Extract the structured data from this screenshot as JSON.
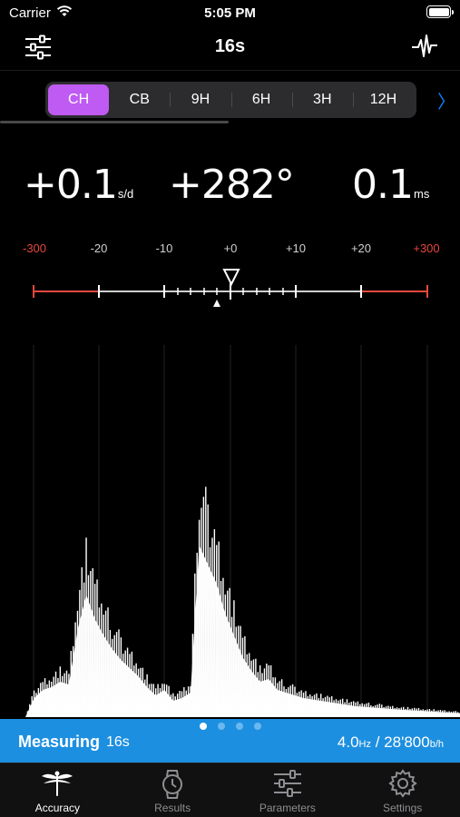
{
  "status_bar": {
    "carrier": "Carrier",
    "time": "5:05 PM"
  },
  "nav": {
    "title": "16s",
    "left_icon": "sliders-icon",
    "right_icon": "waveform-icon"
  },
  "positions": {
    "items": [
      "CH",
      "CB",
      "9H",
      "6H",
      "3H",
      "12H"
    ],
    "selected": "CH",
    "next_chevron": "〉"
  },
  "readouts": {
    "rate": {
      "value": "+0.1",
      "unit": "s/d"
    },
    "amplitude": {
      "value": "+282°"
    },
    "beat_error": {
      "value": "0.1",
      "unit": "ms"
    }
  },
  "scale": {
    "labels": [
      "-300",
      "-20",
      "-10",
      "+0",
      "+10",
      "+20",
      "+300"
    ],
    "red_color": "#e5483e"
  },
  "chart_data": {
    "type": "area",
    "note_values": "relative intensity 0-1 across the timegrapher window",
    "x": [
      0,
      2,
      4,
      6,
      8,
      10,
      12,
      14,
      16,
      18,
      20,
      22,
      24,
      26,
      28,
      30,
      32,
      34,
      36,
      38,
      40,
      42,
      44,
      46,
      48,
      50,
      52,
      54,
      56,
      58,
      60,
      62,
      64,
      66,
      68,
      70,
      72,
      74,
      76,
      78,
      80,
      82,
      84,
      86,
      88,
      90,
      92,
      94,
      96,
      98,
      100
    ],
    "values": [
      0.0,
      0.07,
      0.1,
      0.11,
      0.13,
      0.12,
      0.32,
      0.45,
      0.36,
      0.3,
      0.25,
      0.21,
      0.18,
      0.15,
      0.11,
      0.08,
      0.1,
      0.06,
      0.07,
      0.09,
      0.63,
      0.56,
      0.49,
      0.38,
      0.3,
      0.22,
      0.17,
      0.13,
      0.14,
      0.1,
      0.09,
      0.08,
      0.07,
      0.065,
      0.06,
      0.055,
      0.05,
      0.045,
      0.04,
      0.038,
      0.035,
      0.033,
      0.03,
      0.028,
      0.026,
      0.024,
      0.022,
      0.02,
      0.018,
      0.016,
      0.015
    ]
  },
  "measure_bar": {
    "label": "Measuring",
    "time": "16s",
    "freq_value": "4.0",
    "freq_unit": "Hz",
    "separator": " / ",
    "bph_value": "28'800",
    "bph_unit": "b/h",
    "page_count": 4,
    "page_active": 0
  },
  "tabs": [
    {
      "label": "Accuracy",
      "icon": "dragonfly-icon",
      "active": true
    },
    {
      "label": "Results",
      "icon": "watch-icon",
      "active": false
    },
    {
      "label": "Parameters",
      "icon": "sliders-icon",
      "active": false
    },
    {
      "label": "Settings",
      "icon": "gear-icon",
      "active": false
    }
  ],
  "colors": {
    "accent": "#bf5af2",
    "measure_bar": "#1d8fe0",
    "link": "#0a84ff"
  }
}
